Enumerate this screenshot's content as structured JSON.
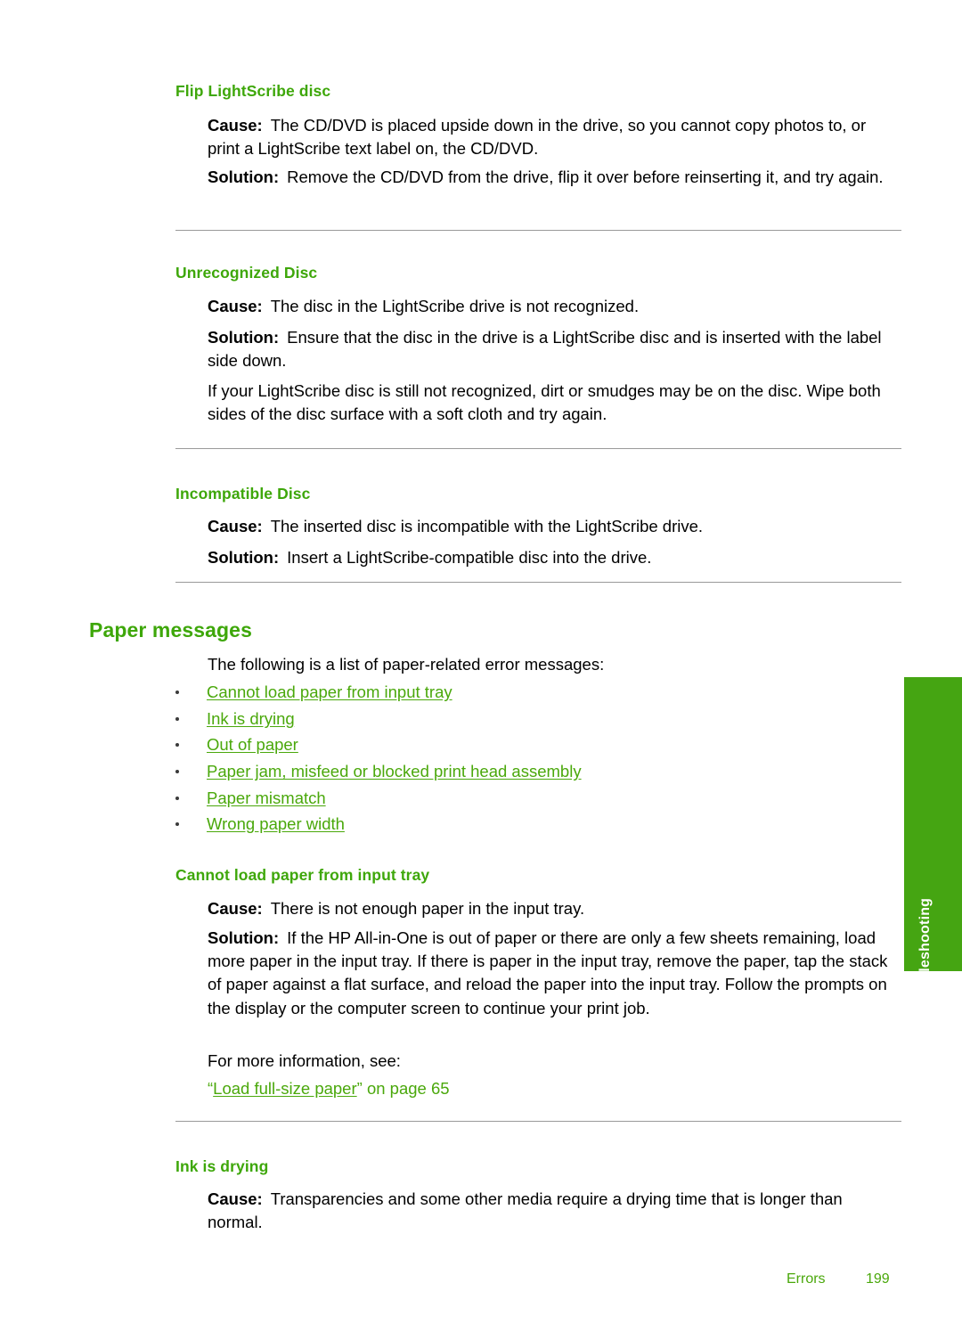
{
  "document": {
    "side_tab_label": "Troubleshooting",
    "footer": {
      "section_label": "Errors",
      "page_number": "199"
    },
    "accent_green": "#3ea70a",
    "link_green": "#4aa80b",
    "tab_green": "#45a512",
    "rule_color": "#9a9a9a"
  },
  "labels": {
    "cause": "Cause:",
    "solution": "Solution:"
  },
  "sections": {
    "flip_lightscribe": {
      "heading": "Flip LightScribe disc",
      "cause": "The CD/DVD is placed upside down in the drive, so you cannot copy photos to, or print a LightScribe text label on, the CD/DVD.",
      "solution": "Remove the CD/DVD from the drive, flip it over before reinserting it, and try again."
    },
    "unrecognized_disc": {
      "heading": "Unrecognized Disc",
      "cause": "The disc in the LightScribe drive is not recognized.",
      "solution": "Ensure that the disc in the drive is a LightScribe disc and is inserted with the label side down.",
      "note": "If your LightScribe disc is still not recognized, dirt or smudges may be on the disc. Wipe both sides of the disc surface with a soft cloth and try again."
    },
    "incompatible_disc": {
      "heading": "Incompatible Disc",
      "cause": "The inserted disc is incompatible with the LightScribe drive.",
      "solution": "Insert a LightScribe-compatible disc into the drive."
    },
    "paper_messages": {
      "heading": "Paper messages",
      "intro": "The following is a list of paper-related error messages:",
      "links": [
        "Cannot load paper from input tray",
        "Ink is drying",
        "Out of paper",
        "Paper jam, misfeed or blocked print head assembly",
        "Paper mismatch",
        "Wrong paper width"
      ]
    },
    "cannot_load_paper": {
      "heading": "Cannot load paper from input tray",
      "cause": "There is not enough paper in the input tray.",
      "solution": "If the HP All-in-One is out of paper or there are only a few sheets remaining, load more paper in the input tray. If there is paper in the input tray, remove the paper, tap the stack of paper against a flat surface, and reload the paper into the input tray. Follow the prompts on the display or the computer screen to continue your print job.",
      "more_info": "For more information, see:",
      "xref_open_quote": "“",
      "xref_link": "Load full-size paper",
      "xref_close_quote": "”",
      "xref_tail": " on page 65"
    },
    "ink_is_drying": {
      "heading": "Ink is drying",
      "cause": "Transparencies and some other media require a drying time that is longer than normal."
    }
  }
}
